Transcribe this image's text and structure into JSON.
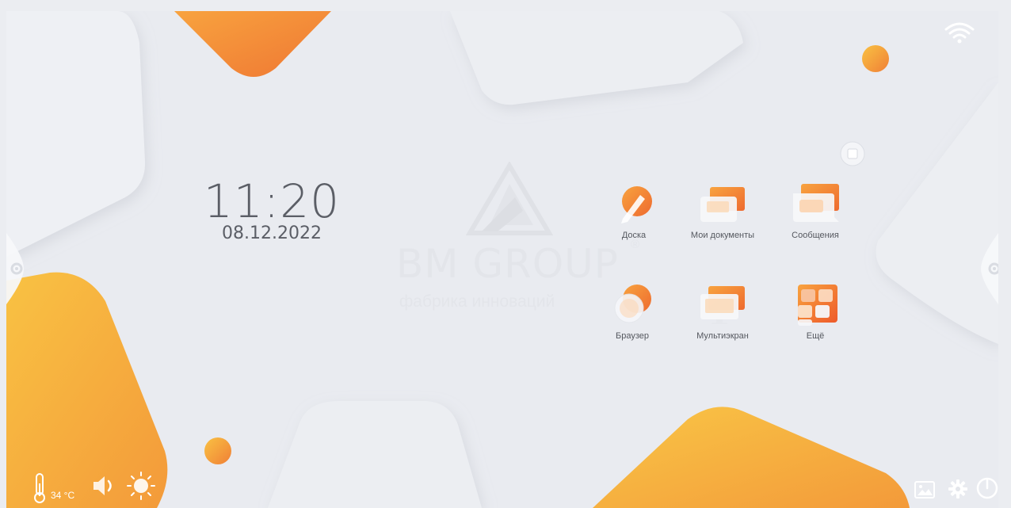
{
  "clock": {
    "time": "11:20",
    "date": "08.12.2022"
  },
  "watermark": {
    "title": "BM GROUP",
    "registered": "®",
    "subtitle": "фабрика инноваций"
  },
  "apps": [
    {
      "id": "doska",
      "label": "Доска",
      "icon": "pen-icon"
    },
    {
      "id": "documents",
      "label": "Мои документы",
      "icon": "folder-icon"
    },
    {
      "id": "messages",
      "label": "Сообщения",
      "icon": "message-icon"
    },
    {
      "id": "browser",
      "label": "Браузер",
      "icon": "browser-icon"
    },
    {
      "id": "multiscreen",
      "label": "Мультиэкран",
      "icon": "monitor-icon"
    },
    {
      "id": "more",
      "label": "Ещё",
      "icon": "apps-grid-icon"
    }
  ],
  "status": {
    "temperature": "34 °C"
  },
  "colors": {
    "accent_orange": "#f07c36",
    "accent_yellow": "#f8bd45",
    "background": "#e9ebf0",
    "text": "#5b5e66"
  }
}
